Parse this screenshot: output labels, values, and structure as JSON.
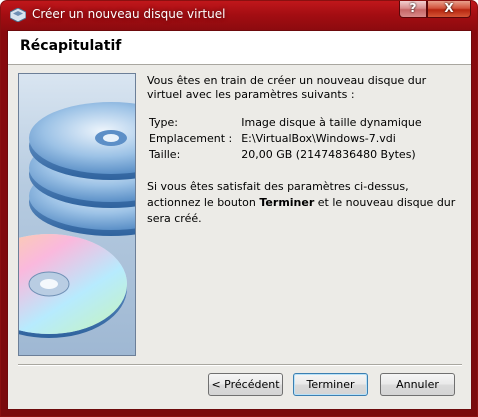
{
  "window": {
    "title": "Créer un nouveau disque virtuel",
    "help_label": "?",
    "close_label": "X"
  },
  "header": {
    "title": "Récapitulatif"
  },
  "summary": {
    "intro": "Vous êtes en train de créer un nouveau disque dur virtuel avec les paramètres suivants :",
    "rows": [
      {
        "key": "Type:",
        "value": "Image disque à taille dynamique"
      },
      {
        "key": "Emplacement :",
        "value": "E:\\VirtualBox\\Windows-7.vdi"
      },
      {
        "key": "Taille:",
        "value": "20,00 GB (21474836480 Bytes)"
      }
    ],
    "footer_before": "Si vous êtes satisfait des paramètres ci-dessus, actionnez le bouton ",
    "footer_bold": "Terminer",
    "footer_after": " et le nouveau disque dur sera créé."
  },
  "buttons": {
    "back": "< Précédent",
    "finish": "Terminer",
    "cancel": "Annuler"
  },
  "icons": {
    "title_icon": "virtualbox-icon",
    "art": "disk-stack-icon"
  },
  "colors": {
    "titlebar": "#a30d12",
    "client_bg": "#ecebe7",
    "art_bg": "#b6cbe0"
  }
}
